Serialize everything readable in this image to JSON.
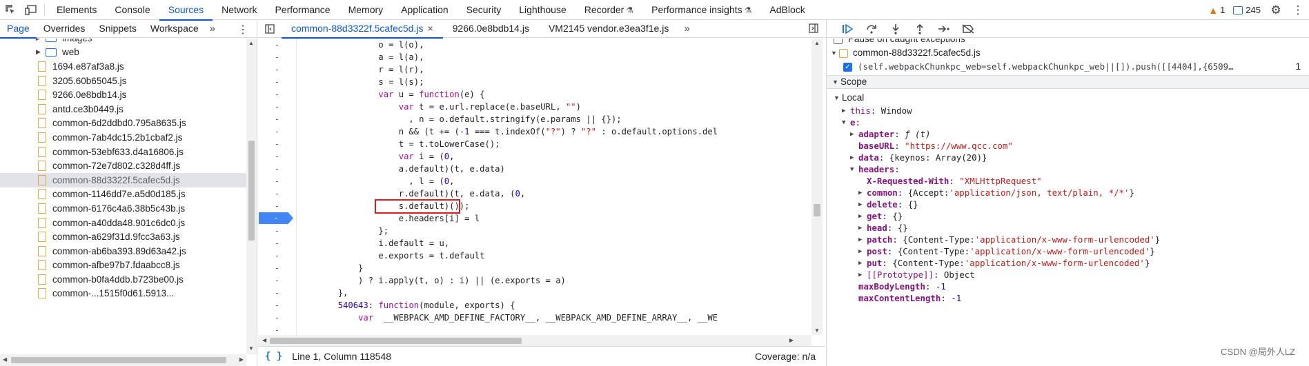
{
  "toolbar": {
    "inspect_icon": "inspect-element-icon",
    "device_icon": "device-toolbar-icon",
    "tabs": [
      {
        "label": "Elements",
        "flask": false
      },
      {
        "label": "Console",
        "flask": false
      },
      {
        "label": "Sources",
        "flask": false,
        "active": true
      },
      {
        "label": "Network",
        "flask": false
      },
      {
        "label": "Performance",
        "flask": false
      },
      {
        "label": "Memory",
        "flask": false
      },
      {
        "label": "Application",
        "flask": false
      },
      {
        "label": "Security",
        "flask": false
      },
      {
        "label": "Lighthouse",
        "flask": false
      },
      {
        "label": "Recorder",
        "flask": true
      },
      {
        "label": "Performance insights",
        "flask": true
      },
      {
        "label": "AdBlock",
        "flask": false
      }
    ],
    "warnings_count": "1",
    "messages_count": "245"
  },
  "navigator": {
    "tabs": [
      "Page",
      "Overrides",
      "Snippets",
      "Workspace"
    ],
    "active_tab": "Page",
    "folders": [
      {
        "name": "images",
        "expanded": false,
        "partial": true
      },
      {
        "name": "web",
        "expanded": false
      }
    ],
    "files": [
      "1694.e87af3a8.js",
      "3205.60b65045.js",
      "9266.0e8bdb14.js",
      "antd.ce3b0449.js",
      "common-6d2ddbd0.795a8635.js",
      "common-7ab4dc15.2b1cbaf2.js",
      "common-53ebf633.d4a16806.js",
      "common-72e7d802.c328d4ff.js",
      "common-88d3322f.5cafec5d.js",
      "common-1146dd7e.a5d0d185.js",
      "common-6176c4a6.38b5c43b.js",
      "common-a40dda48.901c6dc0.js",
      "common-a629f31d.9fcc3a63.js",
      "common-ab6ba393.89d63a42.js",
      "common-afbe97b7.fdaabcc8.js",
      "common-b0fa4ddb.b723be00.js",
      "common-...1515f0d61.5913..."
    ],
    "selected_file": "common-88d3322f.5cafec5d.js"
  },
  "editor": {
    "tabs": [
      {
        "label": "common-88d3322f.5cafec5d.js",
        "active": true,
        "closable": true
      },
      {
        "label": "9266.0e8bdb14.js",
        "active": false,
        "closable": false
      },
      {
        "label": "VM2145 vendor.e3ea3f1e.js",
        "active": false,
        "closable": false
      }
    ],
    "gutter_marks": [
      "-",
      "-",
      "-",
      "-",
      "-",
      "-",
      "-",
      "-",
      "-",
      "-",
      "-",
      "-",
      "-",
      "-",
      "-",
      "-",
      "-",
      "-",
      "-",
      "-",
      "-",
      "-",
      "-",
      "-"
    ],
    "breakpoint_line_index": 12,
    "status": {
      "position": "Line 1, Column 118548",
      "coverage": "Coverage: n/a"
    }
  },
  "debugger": {
    "pause_on_caught": "Pause on caught exceptions",
    "breakpoint_file": "common-88d3322f.5cafec5d.js",
    "breakpoint_code": "(self.webpackChunkpc_web=self.webpackChunkpc_web||[]).push([[4404],{6509…",
    "breakpoint_line": "1",
    "scope_label": "Scope",
    "local_label": "Local",
    "this_key": "this",
    "this_val": "Window",
    "e_key": "e",
    "adapter_key": "adapter",
    "adapter_val": "ƒ (t)",
    "baseurl_key": "baseURL",
    "baseurl_val": "\"https://www.qcc.com\"",
    "data_key": "data",
    "data_val": "{keynos: Array(20)}",
    "headers_key": "headers",
    "xrw_key": "X-Requested-With",
    "xrw_val": "\"XMLHttpRequest\"",
    "common_key": "common",
    "common_open": "{Accept: ",
    "common_str": "'application/json, text/plain, */*'",
    "common_close": "}",
    "delete_key": "delete",
    "get_key": "get",
    "head_key": "head",
    "empty_obj": "{}",
    "patch_key": "patch",
    "post_key": "post",
    "put_key": "put",
    "ct_open": "{Content-Type: ",
    "ct_str": "'application/x-www-form-urlencoded'",
    "ct_close": "}",
    "proto_key": "[[Prototype]]",
    "proto_val": "Object",
    "maxbody_key": "maxBodyLength",
    "maxbody_val": "-1",
    "maxcontent_key": "maxContentLength",
    "maxcontent_val": "-1"
  },
  "watermark": "CSDN @局外人LZ"
}
